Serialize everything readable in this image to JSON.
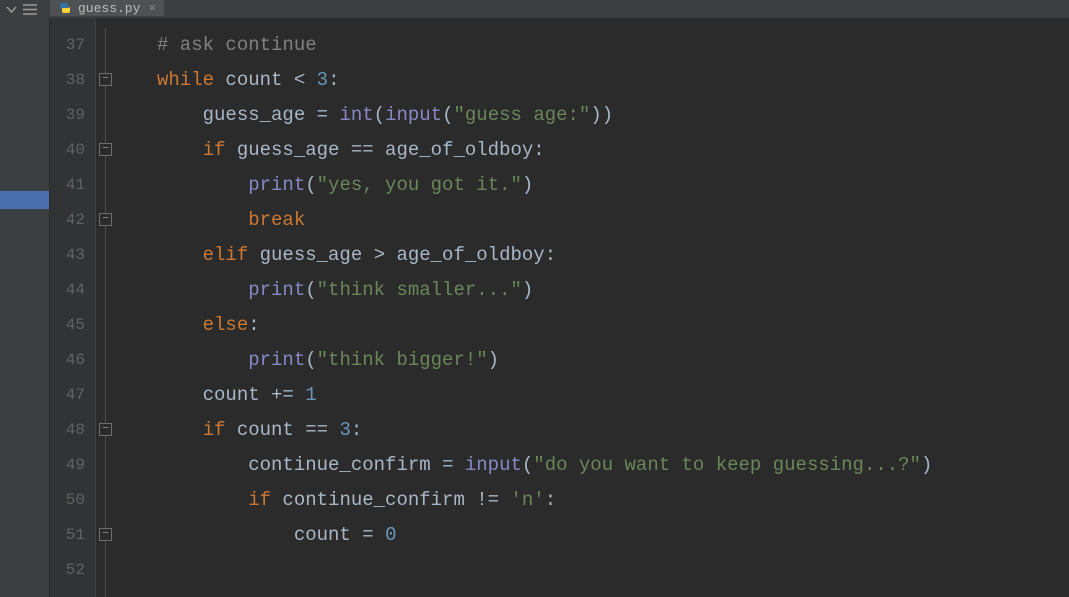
{
  "tab": {
    "filename": "guess.py",
    "close_glyph": "×"
  },
  "editor": {
    "first_line_number": 37,
    "fold_markers": [
      {
        "line": 38,
        "glyph": "−"
      },
      {
        "line": 40,
        "glyph": "−"
      },
      {
        "line": 42,
        "glyph": "−"
      },
      {
        "line": 48,
        "glyph": "−"
      },
      {
        "line": 51,
        "glyph": "−"
      }
    ]
  },
  "code": {
    "lines": [
      {
        "n": 37,
        "indent": 0,
        "tokens": [
          {
            "t": "# ask continue",
            "c": "c-cmt"
          }
        ]
      },
      {
        "n": 38,
        "indent": 0,
        "tokens": [
          {
            "t": "while",
            "c": "c-kw"
          },
          {
            "t": " count ",
            "c": "c-id"
          },
          {
            "t": "<",
            "c": "c-op"
          },
          {
            "t": " ",
            "c": "c-id"
          },
          {
            "t": "3",
            "c": "c-num"
          },
          {
            "t": ":",
            "c": "c-op"
          }
        ]
      },
      {
        "n": 39,
        "indent": 1,
        "tokens": [
          {
            "t": "guess_age ",
            "c": "c-id"
          },
          {
            "t": "=",
            "c": "c-op"
          },
          {
            "t": " ",
            "c": "c-id"
          },
          {
            "t": "int",
            "c": "c-blt"
          },
          {
            "t": "(",
            "c": "c-op"
          },
          {
            "t": "input",
            "c": "c-blt"
          },
          {
            "t": "(",
            "c": "c-op"
          },
          {
            "t": "\"guess age:\"",
            "c": "c-str"
          },
          {
            "t": "))",
            "c": "c-op"
          }
        ]
      },
      {
        "n": 40,
        "indent": 1,
        "tokens": [
          {
            "t": "if",
            "c": "c-kw"
          },
          {
            "t": " guess_age ",
            "c": "c-id"
          },
          {
            "t": "==",
            "c": "c-op"
          },
          {
            "t": " age_of_oldboy",
            "c": "c-id"
          },
          {
            "t": ":",
            "c": "c-op"
          }
        ]
      },
      {
        "n": 41,
        "indent": 2,
        "tokens": [
          {
            "t": "print",
            "c": "c-blt"
          },
          {
            "t": "(",
            "c": "c-op"
          },
          {
            "t": "\"yes, you got it.\"",
            "c": "c-str"
          },
          {
            "t": ")",
            "c": "c-op"
          }
        ]
      },
      {
        "n": 42,
        "indent": 2,
        "tokens": [
          {
            "t": "break",
            "c": "c-kw"
          }
        ]
      },
      {
        "n": 43,
        "indent": 1,
        "tokens": [
          {
            "t": "elif",
            "c": "c-kw"
          },
          {
            "t": " guess_age ",
            "c": "c-id"
          },
          {
            "t": ">",
            "c": "c-op"
          },
          {
            "t": " age_of_oldboy",
            "c": "c-id"
          },
          {
            "t": ":",
            "c": "c-op"
          }
        ]
      },
      {
        "n": 44,
        "indent": 2,
        "tokens": [
          {
            "t": "print",
            "c": "c-blt"
          },
          {
            "t": "(",
            "c": "c-op"
          },
          {
            "t": "\"think smaller...\"",
            "c": "c-str"
          },
          {
            "t": ")",
            "c": "c-op"
          }
        ]
      },
      {
        "n": 45,
        "indent": 1,
        "tokens": [
          {
            "t": "else",
            "c": "c-kw"
          },
          {
            "t": ":",
            "c": "c-op"
          }
        ]
      },
      {
        "n": 46,
        "indent": 2,
        "tokens": [
          {
            "t": "print",
            "c": "c-blt"
          },
          {
            "t": "(",
            "c": "c-op"
          },
          {
            "t": "\"think bigger!\"",
            "c": "c-str"
          },
          {
            "t": ")",
            "c": "c-op"
          }
        ]
      },
      {
        "n": 47,
        "indent": 1,
        "tokens": [
          {
            "t": "count ",
            "c": "c-id"
          },
          {
            "t": "+=",
            "c": "c-op"
          },
          {
            "t": " ",
            "c": "c-id"
          },
          {
            "t": "1",
            "c": "c-num"
          }
        ]
      },
      {
        "n": 48,
        "indent": 1,
        "tokens": [
          {
            "t": "if",
            "c": "c-kw"
          },
          {
            "t": " count ",
            "c": "c-id"
          },
          {
            "t": "==",
            "c": "c-op"
          },
          {
            "t": " ",
            "c": "c-id"
          },
          {
            "t": "3",
            "c": "c-num"
          },
          {
            "t": ":",
            "c": "c-op"
          }
        ]
      },
      {
        "n": 49,
        "indent": 2,
        "tokens": [
          {
            "t": "continue_confirm ",
            "c": "c-id"
          },
          {
            "t": "=",
            "c": "c-op"
          },
          {
            "t": " ",
            "c": "c-id"
          },
          {
            "t": "input",
            "c": "c-blt"
          },
          {
            "t": "(",
            "c": "c-op"
          },
          {
            "t": "\"do you want to keep guessing...?\"",
            "c": "c-str"
          },
          {
            "t": ")",
            "c": "c-op"
          }
        ]
      },
      {
        "n": 50,
        "indent": 2,
        "tokens": [
          {
            "t": "if",
            "c": "c-kw"
          },
          {
            "t": " continue_confirm ",
            "c": "c-id"
          },
          {
            "t": "!=",
            "c": "c-op"
          },
          {
            "t": " ",
            "c": "c-id"
          },
          {
            "t": "'n'",
            "c": "c-str"
          },
          {
            "t": ":",
            "c": "c-op"
          }
        ]
      },
      {
        "n": 51,
        "indent": 3,
        "tokens": [
          {
            "t": "count ",
            "c": "c-id"
          },
          {
            "t": "=",
            "c": "c-op"
          },
          {
            "t": " ",
            "c": "c-id"
          },
          {
            "t": "0",
            "c": "c-num"
          }
        ]
      },
      {
        "n": 52,
        "indent": 0,
        "tokens": []
      }
    ]
  }
}
